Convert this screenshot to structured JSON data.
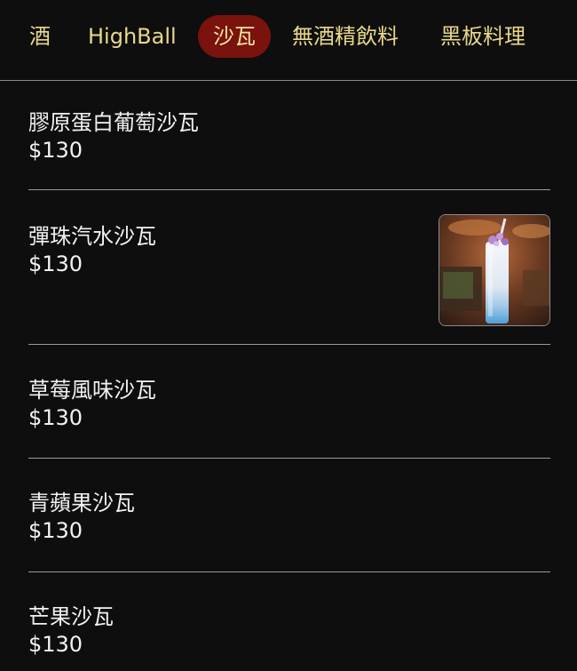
{
  "tabs": [
    {
      "label": "酒",
      "active": false
    },
    {
      "label": "HighBall",
      "active": false
    },
    {
      "label": "沙瓦",
      "active": true
    },
    {
      "label": "無酒精飲料",
      "active": false
    },
    {
      "label": "黑板料理",
      "active": false
    }
  ],
  "items": [
    {
      "name": "膠原蛋白葡萄沙瓦",
      "price": "$130",
      "has_image": false
    },
    {
      "name": "彈珠汽水沙瓦",
      "price": "$130",
      "has_image": true,
      "image_alt": "blue-white layered soda drink in tall glass"
    },
    {
      "name": "草莓風味沙瓦",
      "price": "$130",
      "has_image": false
    },
    {
      "name": "青蘋果沙瓦",
      "price": "$130",
      "has_image": false
    },
    {
      "name": "芒果沙瓦",
      "price": "$130",
      "has_image": false
    }
  ],
  "colors": {
    "background": "#0e0e0e",
    "tab_text": "#e9d88a",
    "active_tab_bg": "#7a120e",
    "item_text": "#f2f2f2",
    "divider": "#9a9a9a"
  }
}
